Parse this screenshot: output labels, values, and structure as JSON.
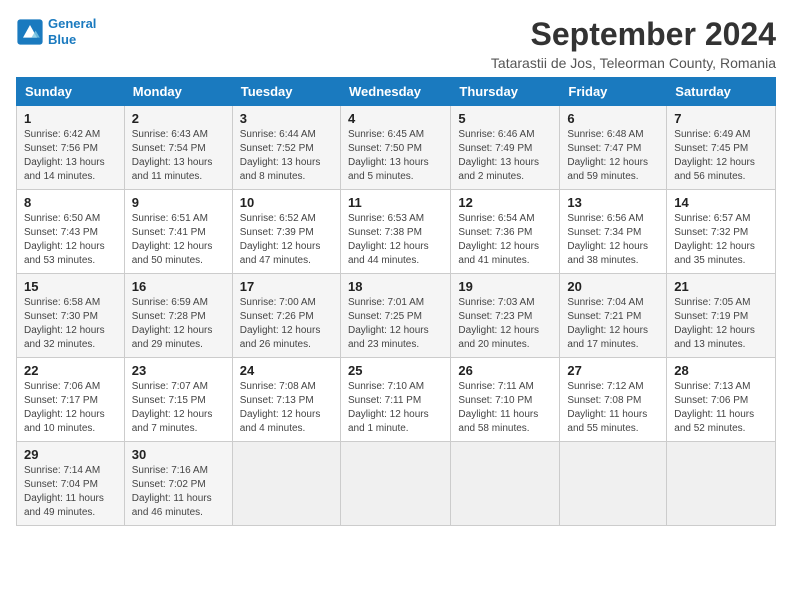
{
  "logo": {
    "line1": "General",
    "line2": "Blue"
  },
  "title": "September 2024",
  "subtitle": "Tatarastii de Jos, Teleorman County, Romania",
  "headers": [
    "Sunday",
    "Monday",
    "Tuesday",
    "Wednesday",
    "Thursday",
    "Friday",
    "Saturday"
  ],
  "weeks": [
    [
      {
        "day": "1",
        "info": "Sunrise: 6:42 AM\nSunset: 7:56 PM\nDaylight: 13 hours and 14 minutes."
      },
      {
        "day": "2",
        "info": "Sunrise: 6:43 AM\nSunset: 7:54 PM\nDaylight: 13 hours and 11 minutes."
      },
      {
        "day": "3",
        "info": "Sunrise: 6:44 AM\nSunset: 7:52 PM\nDaylight: 13 hours and 8 minutes."
      },
      {
        "day": "4",
        "info": "Sunrise: 6:45 AM\nSunset: 7:50 PM\nDaylight: 13 hours and 5 minutes."
      },
      {
        "day": "5",
        "info": "Sunrise: 6:46 AM\nSunset: 7:49 PM\nDaylight: 13 hours and 2 minutes."
      },
      {
        "day": "6",
        "info": "Sunrise: 6:48 AM\nSunset: 7:47 PM\nDaylight: 12 hours and 59 minutes."
      },
      {
        "day": "7",
        "info": "Sunrise: 6:49 AM\nSunset: 7:45 PM\nDaylight: 12 hours and 56 minutes."
      }
    ],
    [
      {
        "day": "8",
        "info": "Sunrise: 6:50 AM\nSunset: 7:43 PM\nDaylight: 12 hours and 53 minutes."
      },
      {
        "day": "9",
        "info": "Sunrise: 6:51 AM\nSunset: 7:41 PM\nDaylight: 12 hours and 50 minutes."
      },
      {
        "day": "10",
        "info": "Sunrise: 6:52 AM\nSunset: 7:39 PM\nDaylight: 12 hours and 47 minutes."
      },
      {
        "day": "11",
        "info": "Sunrise: 6:53 AM\nSunset: 7:38 PM\nDaylight: 12 hours and 44 minutes."
      },
      {
        "day": "12",
        "info": "Sunrise: 6:54 AM\nSunset: 7:36 PM\nDaylight: 12 hours and 41 minutes."
      },
      {
        "day": "13",
        "info": "Sunrise: 6:56 AM\nSunset: 7:34 PM\nDaylight: 12 hours and 38 minutes."
      },
      {
        "day": "14",
        "info": "Sunrise: 6:57 AM\nSunset: 7:32 PM\nDaylight: 12 hours and 35 minutes."
      }
    ],
    [
      {
        "day": "15",
        "info": "Sunrise: 6:58 AM\nSunset: 7:30 PM\nDaylight: 12 hours and 32 minutes."
      },
      {
        "day": "16",
        "info": "Sunrise: 6:59 AM\nSunset: 7:28 PM\nDaylight: 12 hours and 29 minutes."
      },
      {
        "day": "17",
        "info": "Sunrise: 7:00 AM\nSunset: 7:26 PM\nDaylight: 12 hours and 26 minutes."
      },
      {
        "day": "18",
        "info": "Sunrise: 7:01 AM\nSunset: 7:25 PM\nDaylight: 12 hours and 23 minutes."
      },
      {
        "day": "19",
        "info": "Sunrise: 7:03 AM\nSunset: 7:23 PM\nDaylight: 12 hours and 20 minutes."
      },
      {
        "day": "20",
        "info": "Sunrise: 7:04 AM\nSunset: 7:21 PM\nDaylight: 12 hours and 17 minutes."
      },
      {
        "day": "21",
        "info": "Sunrise: 7:05 AM\nSunset: 7:19 PM\nDaylight: 12 hours and 13 minutes."
      }
    ],
    [
      {
        "day": "22",
        "info": "Sunrise: 7:06 AM\nSunset: 7:17 PM\nDaylight: 12 hours and 10 minutes."
      },
      {
        "day": "23",
        "info": "Sunrise: 7:07 AM\nSunset: 7:15 PM\nDaylight: 12 hours and 7 minutes."
      },
      {
        "day": "24",
        "info": "Sunrise: 7:08 AM\nSunset: 7:13 PM\nDaylight: 12 hours and 4 minutes."
      },
      {
        "day": "25",
        "info": "Sunrise: 7:10 AM\nSunset: 7:11 PM\nDaylight: 12 hours and 1 minute."
      },
      {
        "day": "26",
        "info": "Sunrise: 7:11 AM\nSunset: 7:10 PM\nDaylight: 11 hours and 58 minutes."
      },
      {
        "day": "27",
        "info": "Sunrise: 7:12 AM\nSunset: 7:08 PM\nDaylight: 11 hours and 55 minutes."
      },
      {
        "day": "28",
        "info": "Sunrise: 7:13 AM\nSunset: 7:06 PM\nDaylight: 11 hours and 52 minutes."
      }
    ],
    [
      {
        "day": "29",
        "info": "Sunrise: 7:14 AM\nSunset: 7:04 PM\nDaylight: 11 hours and 49 minutes."
      },
      {
        "day": "30",
        "info": "Sunrise: 7:16 AM\nSunset: 7:02 PM\nDaylight: 11 hours and 46 minutes."
      },
      {
        "day": "",
        "info": ""
      },
      {
        "day": "",
        "info": ""
      },
      {
        "day": "",
        "info": ""
      },
      {
        "day": "",
        "info": ""
      },
      {
        "day": "",
        "info": ""
      }
    ]
  ]
}
